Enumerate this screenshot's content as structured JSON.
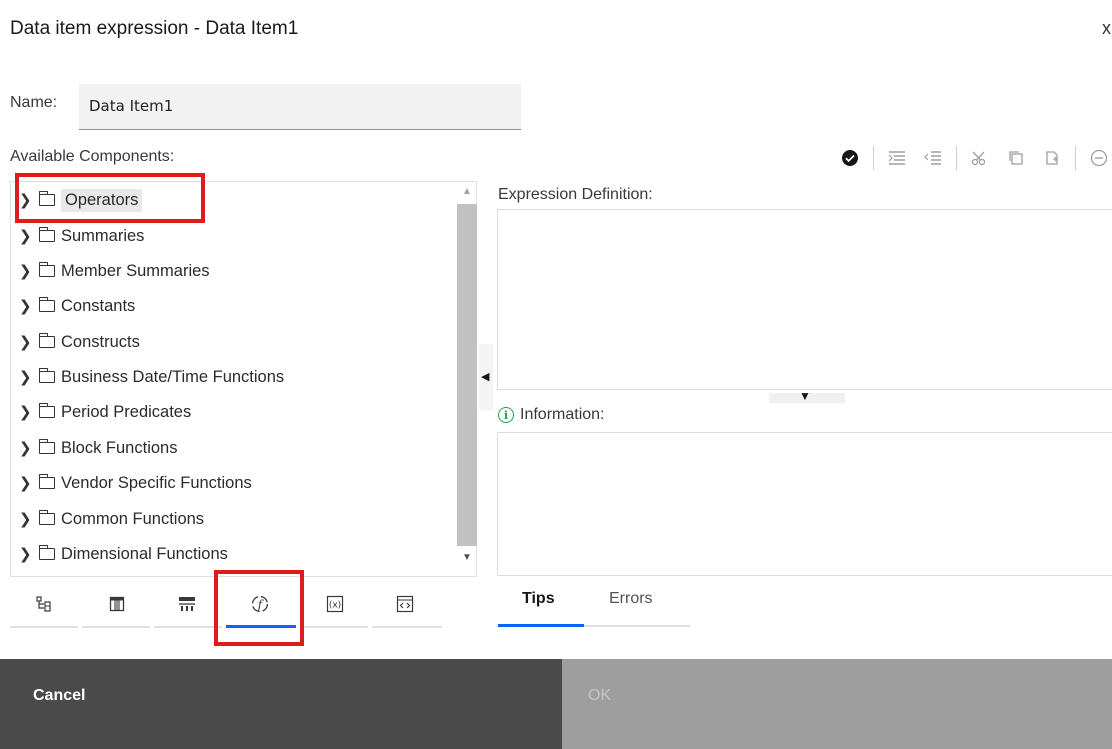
{
  "dialog": {
    "title": "Data item expression - Data Item1",
    "close_glyph": "x"
  },
  "name_field": {
    "label": "Name:",
    "value": "Data Item1"
  },
  "available_components": {
    "label": "Available Components:",
    "items": [
      {
        "label": "Operators",
        "selected": true
      },
      {
        "label": "Summaries"
      },
      {
        "label": "Member Summaries"
      },
      {
        "label": "Constants"
      },
      {
        "label": "Constructs"
      },
      {
        "label": "Business Date/Time Functions"
      },
      {
        "label": "Period Predicates"
      },
      {
        "label": "Block Functions"
      },
      {
        "label": "Vendor Specific Functions"
      },
      {
        "label": "Common Functions"
      },
      {
        "label": "Dimensional Functions"
      }
    ]
  },
  "component_tabs": [
    {
      "icon": "source-tree-icon"
    },
    {
      "icon": "data-items-icon"
    },
    {
      "icon": "query-items-icon"
    },
    {
      "icon": "functions-icon",
      "active": true
    },
    {
      "icon": "parameters-icon"
    },
    {
      "icon": "macros-icon"
    }
  ],
  "toolbar": {
    "icons": [
      "validate-icon",
      "indent-icon",
      "outdent-icon",
      "cut-icon",
      "copy-icon",
      "paste-icon",
      "remove-icon"
    ]
  },
  "expression": {
    "label": "Expression Definition:"
  },
  "information": {
    "label": "Information:"
  },
  "bottom_tabs": {
    "tips": "Tips",
    "errors": "Errors"
  },
  "buttons": {
    "cancel": "Cancel",
    "ok": "OK"
  },
  "colors": {
    "accent": "#0f62fe",
    "highlight": "#e01b1b",
    "info": "#24a148"
  }
}
